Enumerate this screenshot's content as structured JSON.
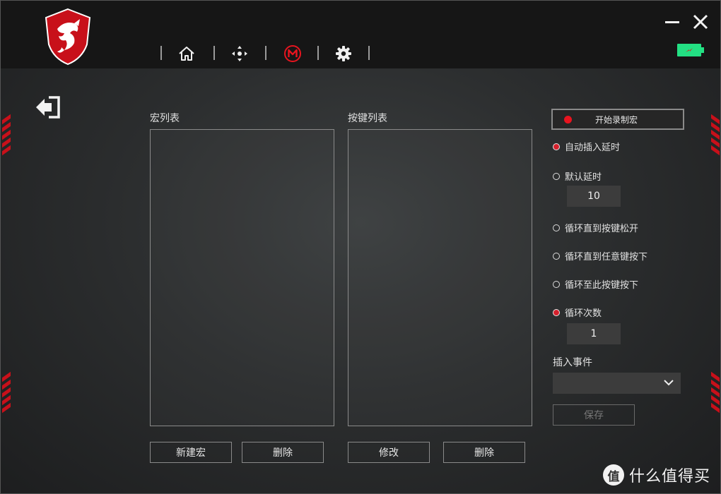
{
  "colors": {
    "accent": "#e8141f",
    "battery": "#23e083",
    "background": "#2c2e2f"
  },
  "nav": {
    "items": [
      {
        "icon": "home-icon"
      },
      {
        "icon": "dpad-icon"
      },
      {
        "icon": "macro-m-icon",
        "active": true
      },
      {
        "icon": "gear-icon"
      }
    ]
  },
  "macro_list": {
    "label": "宏列表",
    "items": []
  },
  "key_list": {
    "label": "按键列表",
    "items": []
  },
  "buttons": {
    "new_macro": "新建宏",
    "delete_macro": "删除",
    "modify": "修改",
    "delete_key": "删除",
    "record": "开始录制宏",
    "save": "保存"
  },
  "delay_options": {
    "auto_insert": {
      "label": "自动插入延时",
      "checked": true
    },
    "default_delay": {
      "label": "默认延时",
      "checked": false,
      "value": "10"
    }
  },
  "loop_options": {
    "until_release": {
      "label": "循环直到按键松开",
      "checked": false
    },
    "until_any_key": {
      "label": "循环直到任意键按下",
      "checked": false
    },
    "until_this_key": {
      "label": "循环至此按键按下",
      "checked": false
    },
    "loop_count": {
      "label": "循环次数",
      "checked": true,
      "value": "1"
    }
  },
  "insert_event": {
    "label": "插入事件",
    "value": ""
  },
  "watermark": {
    "icon": "值",
    "text": "什么值得买"
  }
}
